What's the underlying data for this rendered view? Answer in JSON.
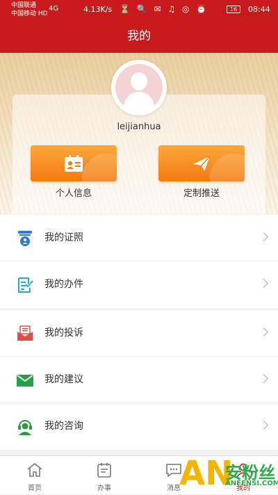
{
  "status_bar": {
    "carrier1": "中国联通",
    "carrier2": "中国移动 HD",
    "net": "4G",
    "speed": "4.13K/s",
    "icons": "⏳ 🔍 ✉ ♫ ◎ ⏰",
    "battery": "16",
    "time": "08:44"
  },
  "header": {
    "title": "我的"
  },
  "profile": {
    "username": "leijianhua"
  },
  "actions": [
    {
      "label": "个人信息",
      "icon": "id-card-icon"
    },
    {
      "label": "定制推送",
      "icon": "paper-plane-icon"
    }
  ],
  "menu_group1": [
    {
      "label": "我的证照",
      "icon": "certificate-icon",
      "color": "#2b7bd6"
    },
    {
      "label": "我的办件",
      "icon": "document-check-icon",
      "color": "#2aa7c9"
    }
  ],
  "menu_group2": [
    {
      "label": "我的投诉",
      "icon": "complaint-mail-icon",
      "color": "#e24b4b"
    },
    {
      "label": "我的建议",
      "icon": "envelope-icon",
      "color": "#23a04a"
    },
    {
      "label": "我的咨询",
      "icon": "headset-user-icon",
      "color": "#2a9d3a"
    }
  ],
  "tabs": [
    {
      "label": "首页",
      "icon": "home-icon"
    },
    {
      "label": "办事",
      "icon": "calendar-icon"
    },
    {
      "label": "消息",
      "icon": "message-icon"
    },
    {
      "label": "我的",
      "icon": "user-icon",
      "active": true
    }
  ],
  "watermark": {
    "big": "AN",
    "cn": "安粉丝",
    "en": "ANFENSI.COM"
  },
  "colors": {
    "brand_red": "#c81a1a",
    "orange": "#f27a12",
    "active_tab": "#c81a1a"
  }
}
